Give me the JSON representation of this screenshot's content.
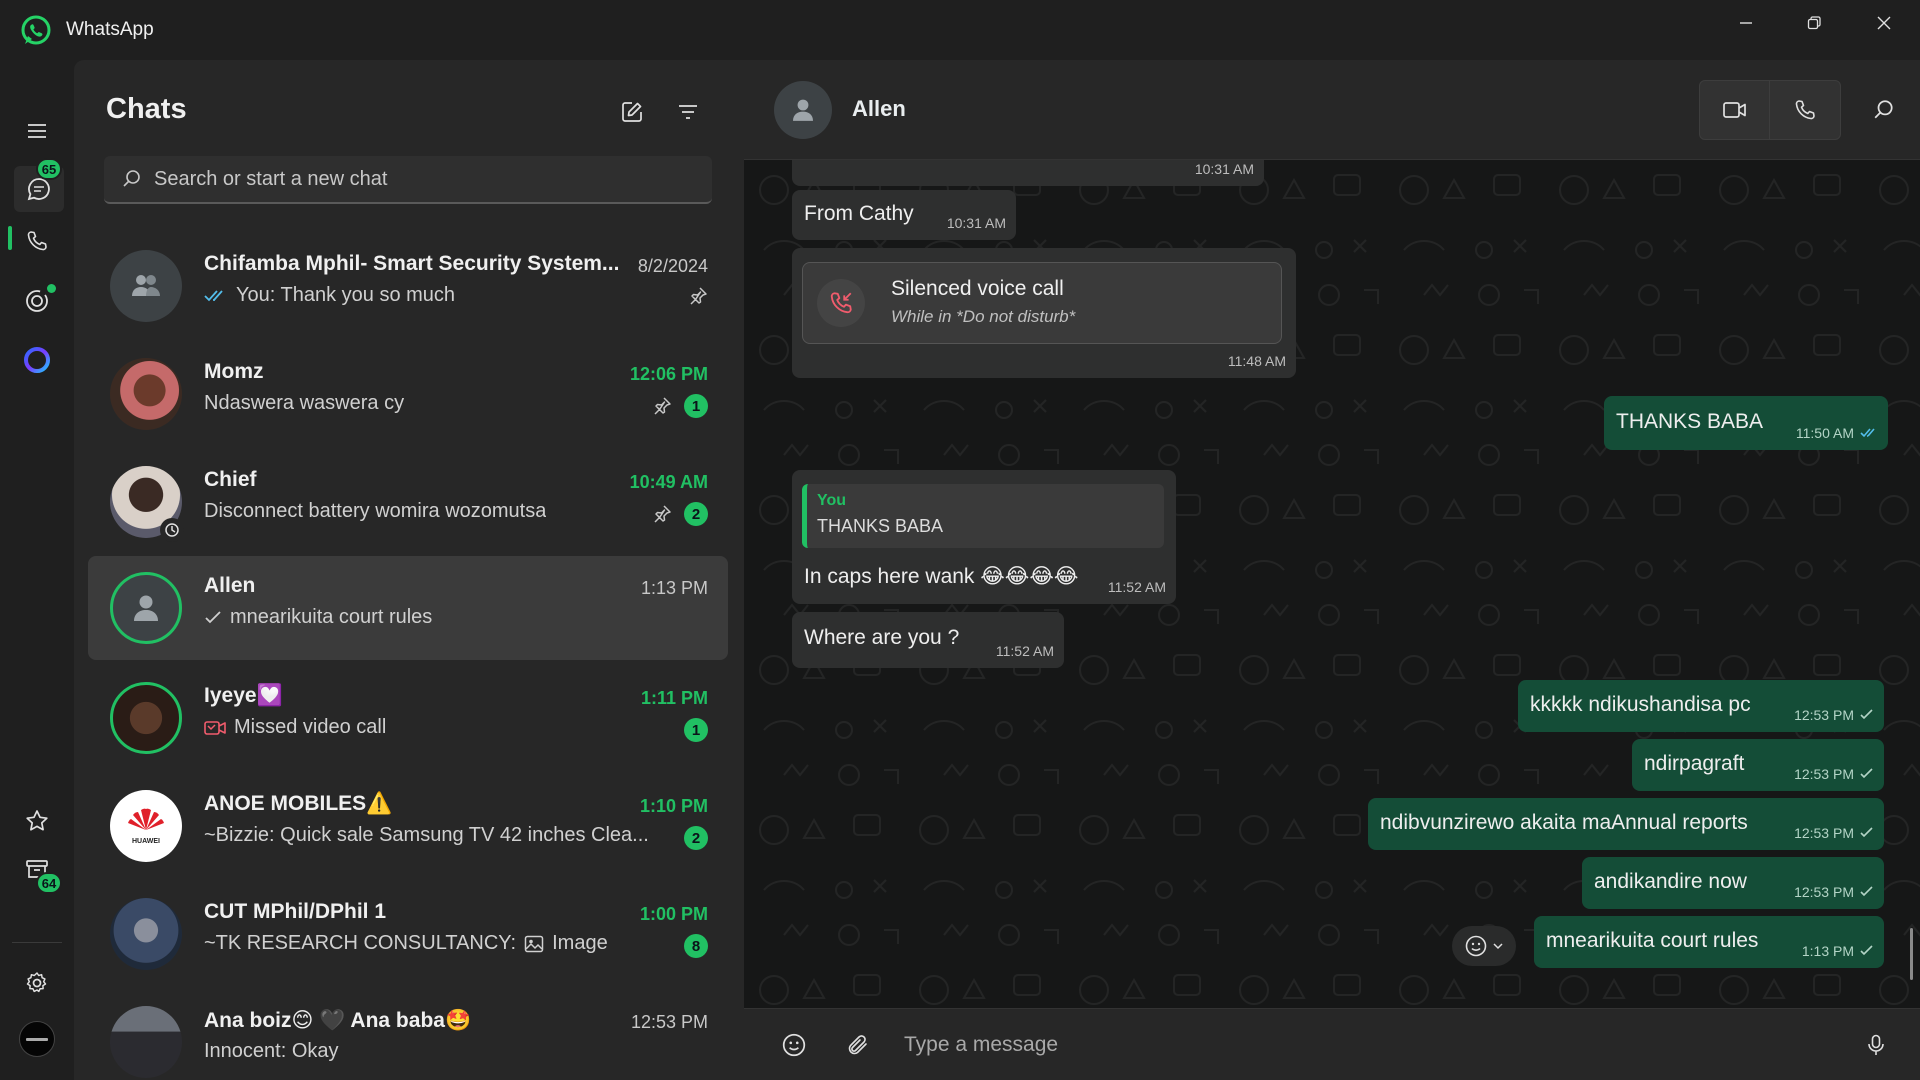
{
  "app": {
    "title": "WhatsApp",
    "brand_color": "#21c063"
  },
  "window_controls": [
    "minimize-icon",
    "restore-icon",
    "close-icon"
  ],
  "rail": {
    "chats_badge": "65",
    "updates_badge": "64",
    "items": [
      "menu-icon",
      "chats-icon",
      "calls-icon",
      "status-icon",
      "meta-ai-icon",
      "starred-icon",
      "archived-icon",
      "settings-icon",
      "profile-avatar"
    ]
  },
  "chatlist": {
    "title": "Chats",
    "search_placeholder": "Search or start a new chat",
    "chats": [
      {
        "name": "Chifamba Mphil- Smart Security System...",
        "preview": "You: Thank you so much",
        "time": "8/2/2024",
        "unread": "",
        "pinned": true
      },
      {
        "name": "Momz",
        "preview": "Ndaswera waswera cy",
        "time": "12:06 PM",
        "unread": "1",
        "pinned": true
      },
      {
        "name": "Chief",
        "preview": "Disconnect  battery womira wozomutsa",
        "time": "10:49 AM",
        "unread": "2",
        "pinned": true
      },
      {
        "name": "Allen",
        "preview": "mnearikuita court rules",
        "time": "1:13 PM",
        "unread": "",
        "pinned": false
      },
      {
        "name": "Iyeye💟",
        "preview": "Missed video call",
        "time": "1:11 PM",
        "unread": "1",
        "pinned": false
      },
      {
        "name": "ANOE MOBILES⚠️",
        "preview": "~Bizzie: Quick sale  Samsung TV  42 inches  Clea...",
        "time": "1:10 PM",
        "unread": "2",
        "pinned": false
      },
      {
        "name": "CUT MPhil/DPhil 1",
        "preview": "~TK RESEARCH CONSULTANCY:",
        "preview_extra": "Image",
        "time": "1:00 PM",
        "unread": "8",
        "pinned": false
      },
      {
        "name": "Ana boiz😊 🖤 Ana baba🤩",
        "preview": "Innocent: Okay",
        "time": "12:53 PM",
        "unread": "",
        "pinned": false
      }
    ]
  },
  "conversation": {
    "contact": "Allen",
    "messages": [
      {
        "dir": "in",
        "text": "",
        "time": "10:31 AM"
      },
      {
        "dir": "in",
        "text": "From Cathy",
        "time": "10:31 AM"
      },
      {
        "dir": "in",
        "type": "call",
        "title": "Silenced voice call",
        "subtitle": "While in *Do not disturb*",
        "time": "11:48 AM"
      },
      {
        "dir": "out",
        "text": "THANKS BABA",
        "time": "11:50 AM"
      },
      {
        "dir": "in",
        "quote_author": "You",
        "quote_text": "THANKS BABA",
        "text": "In caps here wank 😂😂😂😂",
        "time": "11:52 AM"
      },
      {
        "dir": "in",
        "text": "Where are you ?",
        "time": "11:52 AM"
      },
      {
        "dir": "out",
        "text": "kkkkk ndikushandisa pc",
        "time": "12:53 PM"
      },
      {
        "dir": "out",
        "text": "ndirpagraft",
        "time": "12:53 PM"
      },
      {
        "dir": "out",
        "text": "ndibvunzirewo akaita maAnnual reports",
        "time": "12:53 PM"
      },
      {
        "dir": "out",
        "text": "andikandire now",
        "time": "12:53 PM"
      },
      {
        "dir": "out",
        "text": "mnearikuita court rules",
        "time": "1:13 PM"
      }
    ],
    "composer_placeholder": "Type a message"
  }
}
